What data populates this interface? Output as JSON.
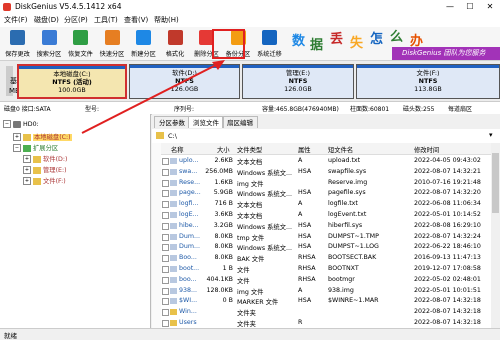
{
  "window": {
    "title": "DiskGenius V5.4.5.1412 x64",
    "minimize": "—",
    "maximize": "☐",
    "close": "✕"
  },
  "menu": [
    "文件(F)",
    "磁盘(D)",
    "分区(P)",
    "工具(T)",
    "查看(V)",
    "帮助(H)"
  ],
  "toolbar": [
    {
      "label": "保存更改",
      "icon": "save-icon",
      "color": "#2b6cb0"
    },
    {
      "label": "搜索分区",
      "icon": "search-partition-icon",
      "color": "#3a7bd5"
    },
    {
      "label": "恢复文件",
      "icon": "recover-file-icon",
      "color": "#2f9e44"
    },
    {
      "label": "快速分区",
      "icon": "quick-partition-icon",
      "color": "#e67e22"
    },
    {
      "label": "新建分区",
      "icon": "new-partition-icon",
      "color": "#1e88e5"
    },
    {
      "label": "格式化",
      "icon": "format-icon",
      "color": "#c0392b"
    },
    {
      "label": "删除分区",
      "icon": "delete-partition-icon",
      "color": "#e53935"
    },
    {
      "label": "备份分区",
      "icon": "backup-partition-icon",
      "color": "#f39c12"
    },
    {
      "label": "系统迁移",
      "icon": "system-migrate-icon",
      "color": "#1565c0"
    }
  ],
  "banner": {
    "chars": [
      {
        "t": "数",
        "c": "#1e88e5"
      },
      {
        "t": "据",
        "c": "#2e7d32"
      },
      {
        "t": "丢",
        "c": "#c62828"
      },
      {
        "t": "失",
        "c": "#f9a825"
      },
      {
        "t": "怎",
        "c": "#1565c0"
      },
      {
        "t": "么",
        "c": "#2e7d32"
      },
      {
        "t": "办",
        "c": "#e65100"
      }
    ],
    "slogan": "DiskGenius 团队为您服务"
  },
  "diskmap": {
    "basic": "基本",
    "mbr": "MBR",
    "partitions": [
      {
        "name": "本地磁盘(C:)",
        "fs": "NTFS (活动)",
        "size": "100.0GB",
        "selected": true
      },
      {
        "name": "软件(D:)",
        "fs": "NTFS",
        "size": "126.0GB",
        "selected": false
      },
      {
        "name": "管理(E:)",
        "fs": "NTFS",
        "size": "126.0GB",
        "selected": false
      },
      {
        "name": "文件(F:)",
        "fs": "NTFS",
        "size": "113.8GB",
        "selected": false
      }
    ]
  },
  "diskinfo": {
    "disk": "磁盘0 接口:SATA",
    "model": "型号:",
    "serial": "序列号:",
    "capacity": "容量:465.8GB(476940MB)",
    "cylinders": "柱面数:60801",
    "heads": "磁头数:255",
    "sectors": "每道扇区"
  },
  "tree": {
    "disk": "HD0:",
    "items": [
      {
        "label": "本地磁盘(C:)",
        "indent": 1,
        "selected": true,
        "color": "#a33",
        "expander": "+"
      },
      {
        "label": "扩展分区",
        "indent": 1,
        "selected": false,
        "color": "#2e7d32",
        "expander": "−"
      },
      {
        "label": "软件(D:)",
        "indent": 2,
        "selected": false,
        "color": "#a33",
        "expander": "+"
      },
      {
        "label": "管理(E:)",
        "indent": 2,
        "selected": false,
        "color": "#a33",
        "expander": "+"
      },
      {
        "label": "文件(F:)",
        "indent": 2,
        "selected": false,
        "color": "#a33",
        "expander": "+"
      }
    ]
  },
  "tabs": [
    "分区参数",
    "浏览文件",
    "扇区编辑"
  ],
  "active_tab": 1,
  "path": "C:\\",
  "columns": {
    "name": "名称",
    "size": "大小",
    "type": "文件类型",
    "attr": "属性",
    "short": "短文件名",
    "mtime": "修改时间"
  },
  "files": [
    {
      "name": "uplo...",
      "size": "2.6KB",
      "type": "文本文档",
      "attr": "A",
      "short": "upload.txt",
      "mtime": "2022-04-05 09:43:02",
      "kind": "file"
    },
    {
      "name": "swa...",
      "size": "256.0MB",
      "type": "Windows 系统文...",
      "attr": "HSA",
      "short": "swapfile.sys",
      "mtime": "2022-08-07 14:32:21",
      "kind": "file"
    },
    {
      "name": "Rese...",
      "size": "1.6KB",
      "type": "img 文件",
      "attr": "",
      "short": "Reserve.img",
      "mtime": "2010-07-16 19:21:48",
      "kind": "file"
    },
    {
      "name": "page...",
      "size": "5.9GB",
      "type": "Windows 系统文...",
      "attr": "HSA",
      "short": "pagefile.sys",
      "mtime": "2022-08-07 14:32:20",
      "kind": "file"
    },
    {
      "name": "logfi...",
      "size": "716 B",
      "type": "文本文档",
      "attr": "A",
      "short": "logfile.txt",
      "mtime": "2022-06-08 11:06:34",
      "kind": "file"
    },
    {
      "name": "logE...",
      "size": "3.6KB",
      "type": "文本文档",
      "attr": "A",
      "short": "logEvent.txt",
      "mtime": "2022-05-01 10:14:52",
      "kind": "file"
    },
    {
      "name": "hibe...",
      "size": "3.2GB",
      "type": "Windows 系统文...",
      "attr": "HSA",
      "short": "hiberfil.sys",
      "mtime": "2022-08-08 16:29:10",
      "kind": "file"
    },
    {
      "name": "Dum...",
      "size": "8.0KB",
      "type": "tmp 文件",
      "attr": "HSA",
      "short": "DUMPST~1.TMP",
      "mtime": "2022-08-07 14:32:24",
      "kind": "file"
    },
    {
      "name": "Dum...",
      "size": "8.0KB",
      "type": "Windows 系统文...",
      "attr": "HSA",
      "short": "DUMPST~1.LOG",
      "mtime": "2022-06-22 18:46:10",
      "kind": "file"
    },
    {
      "name": "Boo...",
      "size": "8.0KB",
      "type": "BAK 文件",
      "attr": "RHSA",
      "short": "BOOTSECT.BAK",
      "mtime": "2016-09-13 11:47:13",
      "kind": "file"
    },
    {
      "name": "boot...",
      "size": "1 B",
      "type": "文件",
      "attr": "RHSA",
      "short": "BOOTNXT",
      "mtime": "2019-12-07 17:08:58",
      "kind": "file"
    },
    {
      "name": "boo...",
      "size": "404.1KB",
      "type": "文件",
      "attr": "RHSA",
      "short": "bootmgr",
      "mtime": "2022-05-02 02:48:01",
      "kind": "file"
    },
    {
      "name": "938...",
      "size": "128.0KB",
      "type": "img 文件",
      "attr": "A",
      "short": "938.img",
      "mtime": "2022-05-01 10:01:51",
      "kind": "file"
    },
    {
      "name": "$WI...",
      "size": "0 B",
      "type": "MARKER 文件",
      "attr": "HSA",
      "short": "$WINRE~1.MAR",
      "mtime": "2022-08-07 14:32:18",
      "kind": "file"
    },
    {
      "name": "Win...",
      "size": "",
      "type": "文件夹",
      "attr": "",
      "short": "",
      "mtime": "2022-08-07 14:32:18",
      "kind": "folder"
    },
    {
      "name": "Users",
      "size": "",
      "type": "文件夹",
      "attr": "R",
      "short": "",
      "mtime": "2022-08-07 14:32:18",
      "kind": "folder"
    }
  ],
  "status": "就绪"
}
